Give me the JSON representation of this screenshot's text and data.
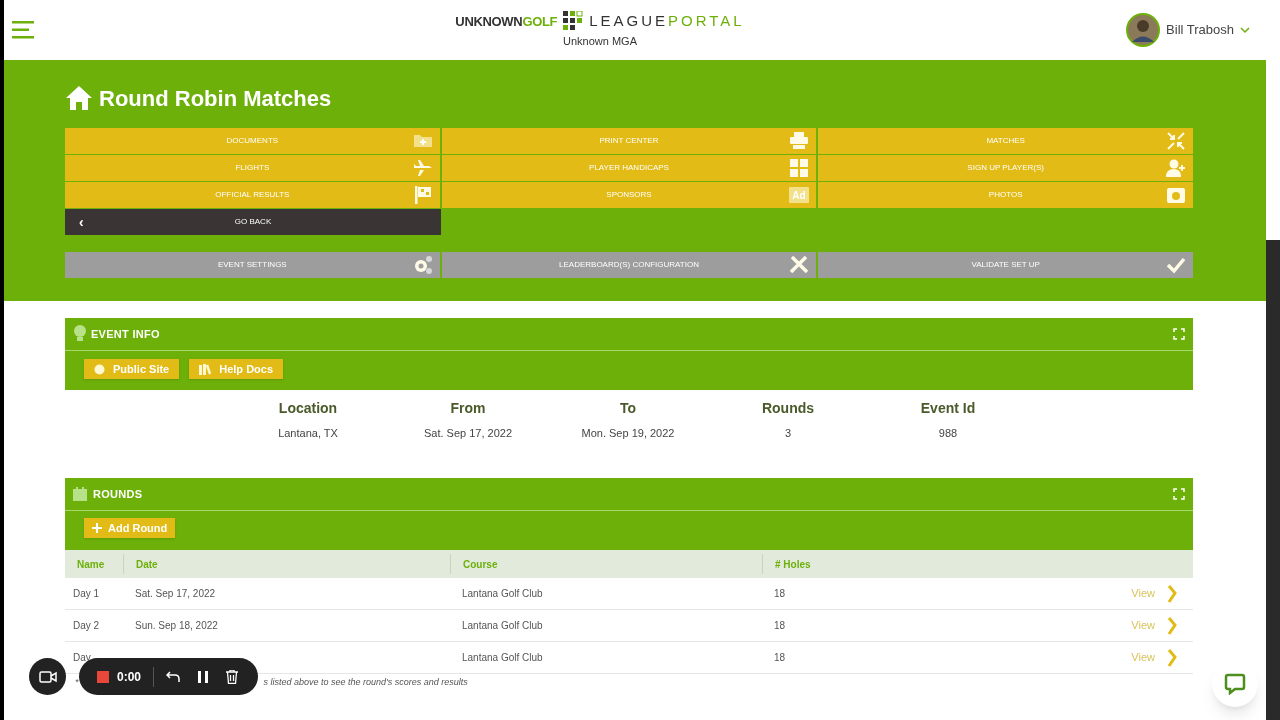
{
  "header": {
    "brand_left": "UNKNOWN",
    "brand_mid": "GOLF",
    "brand_right_a": "LEAGUE",
    "brand_right_b": "PORTAL",
    "org": "Unknown MGA",
    "user": "Bill Trabosh"
  },
  "page_title": "Round Robin Matches",
  "nav_buttons": [
    {
      "label": "DOCUMENTS"
    },
    {
      "label": "PRINT CENTER"
    },
    {
      "label": "MATCHES"
    },
    {
      "label": "FLIGHTS"
    },
    {
      "label": "PLAYER HANDICAPS"
    },
    {
      "label": "SIGN UP PLAYER(S)"
    },
    {
      "label": "OFFICIAL RESULTS"
    },
    {
      "label": "SPONSORS",
      "icon_text": "Ad"
    },
    {
      "label": "PHOTOS"
    }
  ],
  "go_back": {
    "icon": "‹",
    "label": "GO BACK"
  },
  "settings_buttons": [
    {
      "label": "EVENT SETTINGS"
    },
    {
      "label": "LEADERBOARD(S) CONFIGURATION"
    },
    {
      "label": "VALIDATE SET UP"
    }
  ],
  "event_info": {
    "title": "EVENT INFO",
    "buttons": [
      "Public Site",
      "Help Docs"
    ],
    "fields": [
      {
        "label": "Location",
        "value": "Lantana, TX"
      },
      {
        "label": "From",
        "value": "Sat. Sep 17, 2022"
      },
      {
        "label": "To",
        "value": "Mon. Sep 19, 2022"
      },
      {
        "label": "Rounds",
        "value": "3"
      },
      {
        "label": "Event Id",
        "value": "988"
      }
    ]
  },
  "rounds": {
    "title": "ROUNDS",
    "add_button": "Add Round",
    "columns": [
      "Name",
      "Date",
      "Course",
      "# Holes"
    ],
    "rows": [
      {
        "name": "Day 1",
        "date": "Sat. Sep 17, 2022",
        "course": "Lantana Golf Club",
        "holes": "18",
        "action": "View"
      },
      {
        "name": "Day 2",
        "date": "Sun. Sep 18, 2022",
        "course": "Lantana Golf Club",
        "holes": "18",
        "action": "View"
      },
      {
        "name": "Day",
        "course": "Lantana Golf Club",
        "holes": "18",
        "action": "View"
      }
    ],
    "footnote_start": "*",
    "footnote_end": "s listed above to see the round's scores and results"
  },
  "recorder": {
    "time": "0:00"
  }
}
